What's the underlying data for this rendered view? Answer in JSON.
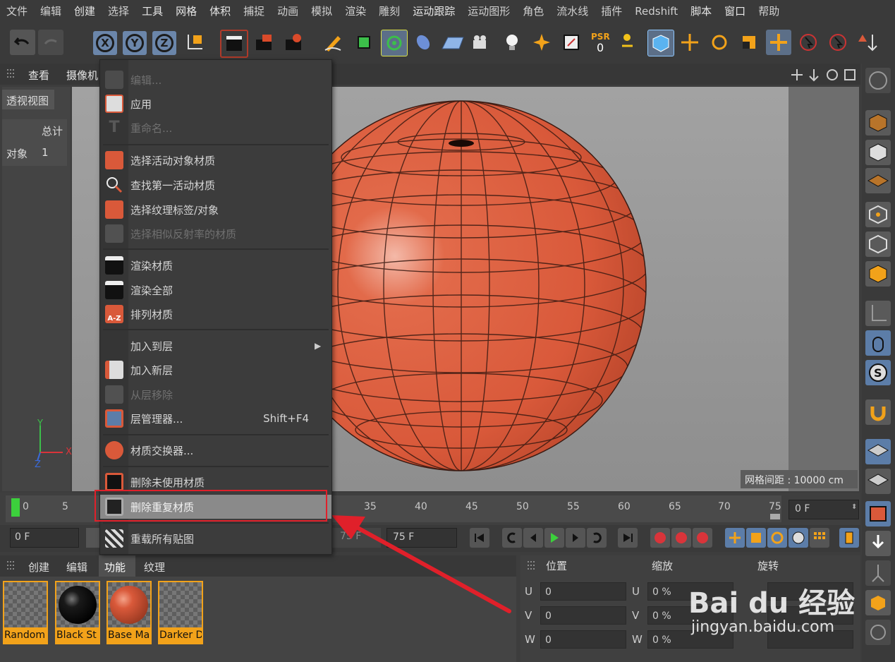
{
  "menubar": {
    "items": [
      "文件",
      "编辑",
      "创建",
      "选择",
      "工具",
      "网格",
      "体积",
      "捕捉",
      "动画",
      "模拟",
      "渲染",
      "雕刻",
      "运动跟踪",
      "运动图形",
      "角色",
      "流水线",
      "插件",
      "Redshift",
      "脚本",
      "窗口",
      "帮助"
    ]
  },
  "viewport": {
    "header_view": "查看",
    "header_camera": "摄像机",
    "view_name": "透视视图",
    "stats_total_label": "总计",
    "stats_object_label": "对象",
    "stats_object_count": "1",
    "grid_spacing": "网格间距 : 10000 cm",
    "axis_y": "Y",
    "axis_x": "X",
    "axis_z": "Z"
  },
  "context_menu": {
    "items": [
      {
        "label": "编辑...",
        "disabled": true
      },
      {
        "label": "应用",
        "disabled": false
      },
      {
        "label": "重命名...",
        "disabled": true
      },
      {
        "label": "选择活动对象材质",
        "disabled": false
      },
      {
        "label": "查找第一活动材质",
        "disabled": false
      },
      {
        "label": "选择纹理标签/对象",
        "disabled": false
      },
      {
        "label": "选择相似反射率的材质",
        "disabled": true
      },
      {
        "label": "渲染材质",
        "disabled": false
      },
      {
        "label": "渲染全部",
        "disabled": false
      },
      {
        "label": "排列材质",
        "disabled": false
      },
      {
        "label": "加入到层",
        "disabled": false,
        "submenu": true
      },
      {
        "label": "加入新层",
        "disabled": false
      },
      {
        "label": "从层移除",
        "disabled": true
      },
      {
        "label": "层管理器...",
        "disabled": false,
        "shortcut": "Shift+F4"
      },
      {
        "label": "材质交换器...",
        "disabled": false
      },
      {
        "label": "删除未使用材质",
        "disabled": false
      },
      {
        "label": "删除重复材质",
        "disabled": false,
        "highlighted": true
      },
      {
        "label": "重载所有贴图",
        "disabled": false
      }
    ]
  },
  "timeline": {
    "ticks": [
      "0",
      "5",
      "35",
      "40",
      "45",
      "50",
      "55",
      "60",
      "65",
      "70",
      "75"
    ],
    "current_frame": "0 F",
    "start_frame": "0 F",
    "end_frame_1": "75 F",
    "end_frame_2": "75 F"
  },
  "material_manager": {
    "tabs": [
      "创建",
      "编辑",
      "功能",
      "纹理"
    ],
    "active_tab": "功能",
    "materials": [
      "Random",
      "Black St",
      "Base Ma",
      "Darker D"
    ]
  },
  "coordinates": {
    "headers": [
      "位置",
      "缩放",
      "旋转"
    ],
    "rows": [
      {
        "axis": "U",
        "position": "0",
        "scale_axis": "U",
        "scale": "0 %"
      },
      {
        "axis": "V",
        "position": "0",
        "scale_axis": "V",
        "scale": "0 %"
      },
      {
        "axis": "W",
        "position": "0",
        "scale_axis": "W",
        "scale": "0 %"
      }
    ]
  },
  "watermark": {
    "brand": "Bai du 经验",
    "url": "jingyan.baidu.com"
  },
  "colors": {
    "accent_orange": "#f2a21a",
    "sphere": "#d9593a",
    "highlight_red": "#e0202a"
  }
}
